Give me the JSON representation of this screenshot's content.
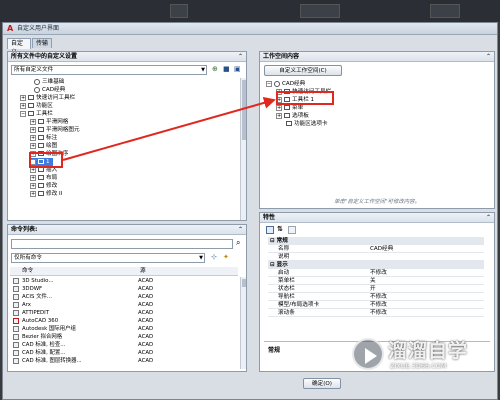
{
  "window": {
    "title": "自定义用户界面"
  },
  "tabs": [
    {
      "label": "自定义"
    },
    {
      "label": "传输"
    }
  ],
  "customizations_panel": {
    "header": "所有文件中的自定义设置",
    "filter_value": "所有自定义文件",
    "tree": [
      {
        "label": "三维基础"
      },
      {
        "label": "CAD经典"
      },
      {
        "label": "快速访问工具栏"
      },
      {
        "label": "功能区"
      },
      {
        "label": "工具栏"
      },
      {
        "label": "平滑网格"
      },
      {
        "label": "平滑网格图元"
      },
      {
        "label": "标注"
      },
      {
        "label": "绘图"
      },
      {
        "label": "绘图次序"
      },
      {
        "label": "1"
      },
      {
        "label": "插入"
      },
      {
        "label": "布局"
      },
      {
        "label": "修改"
      },
      {
        "label": "修改 II"
      }
    ]
  },
  "command_panel": {
    "header": "命令列表:",
    "filter_value": "仅所有命令",
    "columns": [
      "命令",
      "源"
    ],
    "rows": [
      {
        "cmd": "3D Studio...",
        "src": "ACAD"
      },
      {
        "cmd": "3DDWF",
        "src": "ACAD"
      },
      {
        "cmd": "ACIS 文件...",
        "src": "ACAD"
      },
      {
        "cmd": "Arx",
        "src": "ACAD"
      },
      {
        "cmd": "ATTIPEDIT",
        "src": "ACAD"
      },
      {
        "cmd": "AutoCAD 360",
        "src": "ACAD"
      },
      {
        "cmd": "Autodesk 国际用户组",
        "src": "ACAD"
      },
      {
        "cmd": "Bezier 拟合网格",
        "src": "ACAD"
      },
      {
        "cmd": "CAD 标准, 检查...",
        "src": "ACAD"
      },
      {
        "cmd": "CAD 标准, 配置...",
        "src": "ACAD"
      },
      {
        "cmd": "CAD 标准, 图层转换器...",
        "src": "ACAD"
      }
    ]
  },
  "workspace_panel": {
    "header": "工作空间内容",
    "customize_button": "自定义工作空间(C)",
    "tree": [
      {
        "label": "CAD经典"
      },
      {
        "label": "快速访问工具栏"
      },
      {
        "label": "工具栏 1"
      },
      {
        "label": "菜单"
      },
      {
        "label": "选项板"
      },
      {
        "label": "功能区选项卡"
      }
    ],
    "hint": "单击\"自定义工作空间\"可修改内容。"
  },
  "properties_panel": {
    "header": "特性",
    "categories": [
      {
        "name": "常规",
        "rows": [
          {
            "key": "名称",
            "value": "CAD经典"
          },
          {
            "key": "说明",
            "value": ""
          }
        ]
      },
      {
        "name": "显示",
        "rows": [
          {
            "key": "启动",
            "value": "不修改"
          },
          {
            "key": "菜单栏",
            "value": "关"
          },
          {
            "key": "状态栏",
            "value": "开"
          },
          {
            "key": "导航栏",
            "value": "不修改"
          },
          {
            "key": "模型/布局选项卡",
            "value": "不修改"
          },
          {
            "key": "滚动条",
            "value": "不修改"
          }
        ]
      }
    ],
    "description_title": "常规"
  },
  "footer": {
    "ok_label": "确定(O)"
  },
  "watermark": {
    "brand": "溜溜自学",
    "url": "ZIXUE.3D66.COM"
  },
  "colors": {
    "highlight_red": "#e0281e",
    "panel_header": "#dbe2ea"
  }
}
